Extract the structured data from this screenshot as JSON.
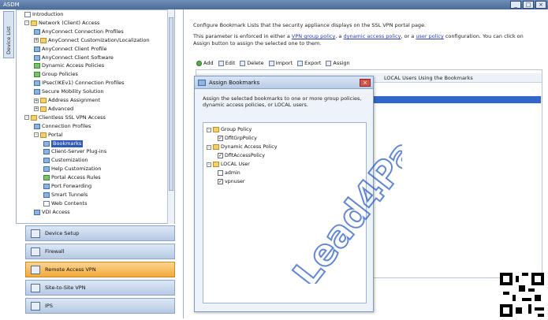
{
  "window": {
    "title": "ASDM"
  },
  "side_tab": {
    "label": "Device List"
  },
  "tree": [
    {
      "label": "Introduction",
      "indent": 0,
      "icon": "doc"
    },
    {
      "label": "Network (Client) Access",
      "indent": 0,
      "icon": "folder",
      "exp": "-"
    },
    {
      "label": "AnyConnect Connection Profiles",
      "indent": 1,
      "icon": "blue"
    },
    {
      "label": "AnyConnect Customization/Localization",
      "indent": 1,
      "icon": "folder",
      "exp": "+"
    },
    {
      "label": "AnyConnect Client Profile",
      "indent": 1,
      "icon": "blue"
    },
    {
      "label": "AnyConnect Client Software",
      "indent": 1,
      "icon": "blue"
    },
    {
      "label": "Dynamic Access Policies",
      "indent": 1,
      "icon": "green"
    },
    {
      "label": "Group Policies",
      "indent": 1,
      "icon": "green"
    },
    {
      "label": "IPsec(IKEv1) Connection Profiles",
      "indent": 1,
      "icon": "blue"
    },
    {
      "label": "Secure Mobility Solution",
      "indent": 1,
      "icon": "blue"
    },
    {
      "label": "Address Assignment",
      "indent": 1,
      "icon": "folder",
      "exp": "+"
    },
    {
      "label": "Advanced",
      "indent": 1,
      "icon": "folder",
      "exp": "+"
    },
    {
      "label": "Clientless SSL VPN Access",
      "indent": 0,
      "icon": "folder",
      "exp": "-"
    },
    {
      "label": "Connection Profiles",
      "indent": 1,
      "icon": "blue"
    },
    {
      "label": "Portal",
      "indent": 1,
      "icon": "folder",
      "exp": "-"
    },
    {
      "label": "Bookmarks",
      "indent": 2,
      "icon": "blue",
      "selected": true
    },
    {
      "label": "Client-Server Plug-ins",
      "indent": 2,
      "icon": "blue"
    },
    {
      "label": "Customization",
      "indent": 2,
      "icon": "blue"
    },
    {
      "label": "Help Customization",
      "indent": 2,
      "icon": "blue"
    },
    {
      "label": "Portal Access Rules",
      "indent": 2,
      "icon": "green"
    },
    {
      "label": "Port Forwarding",
      "indent": 2,
      "icon": "blue"
    },
    {
      "label": "Smart Tunnels",
      "indent": 2,
      "icon": "blue"
    },
    {
      "label": "Web Contents",
      "indent": 2,
      "icon": "doc"
    },
    {
      "label": "VDI Access",
      "indent": 1,
      "icon": "blue"
    }
  ],
  "nav": [
    {
      "label": "Device Setup",
      "active": false,
      "name": "nav-device-setup"
    },
    {
      "label": "Firewall",
      "active": false,
      "name": "nav-firewall"
    },
    {
      "label": "Remote Access VPN",
      "active": true,
      "name": "nav-remote-access-vpn"
    },
    {
      "label": "Site-to-Site VPN",
      "active": false,
      "name": "nav-site-to-site-vpn"
    },
    {
      "label": "IPS",
      "active": false,
      "name": "nav-ips"
    }
  ],
  "content": {
    "desc1": "Configure Bookmark Lists that the security appliance displays on the SSL VPN portal page.",
    "desc2_pre": "This parameter is enforced in either a ",
    "link_vpn_group": "VPN group policy",
    "desc2_mid1": ", a ",
    "link_dap": "dynamic access policy",
    "desc2_mid2": ", or a ",
    "link_user": "user policy",
    "desc2_post": " configuration. You can click on",
    "desc3": "Assign button to assign the selected one to them.",
    "toolbar": {
      "add": "Add",
      "edit": "Edit",
      "delete": "Delete",
      "import": "Import",
      "export": "Export",
      "assign": "Assign"
    },
    "table_header": "LOCAL Users Using the Bookmarks"
  },
  "dialog": {
    "title": "Assign Bookmarks",
    "desc": "Assign the selected bookmarks to one or more group policies, dynamic access policies, or LOCAL users.",
    "items": [
      {
        "label": "Group Policy",
        "indent": 0,
        "type": "folder",
        "exp": "-"
      },
      {
        "label": "DfltGrpPolicy",
        "indent": 1,
        "type": "check",
        "checked": true
      },
      {
        "label": "Dynamic Access Policy",
        "indent": 0,
        "type": "folder",
        "exp": "-"
      },
      {
        "label": "DfltAccessPolicy",
        "indent": 1,
        "type": "check",
        "checked": true
      },
      {
        "label": "LOCAL User",
        "indent": 0,
        "type": "folder",
        "exp": "-"
      },
      {
        "label": "admin",
        "indent": 1,
        "type": "check",
        "checked": false
      },
      {
        "label": "vpnuser",
        "indent": 1,
        "type": "check",
        "checked": true
      }
    ]
  },
  "watermark": {
    "text": "Lead4Pass.com"
  }
}
